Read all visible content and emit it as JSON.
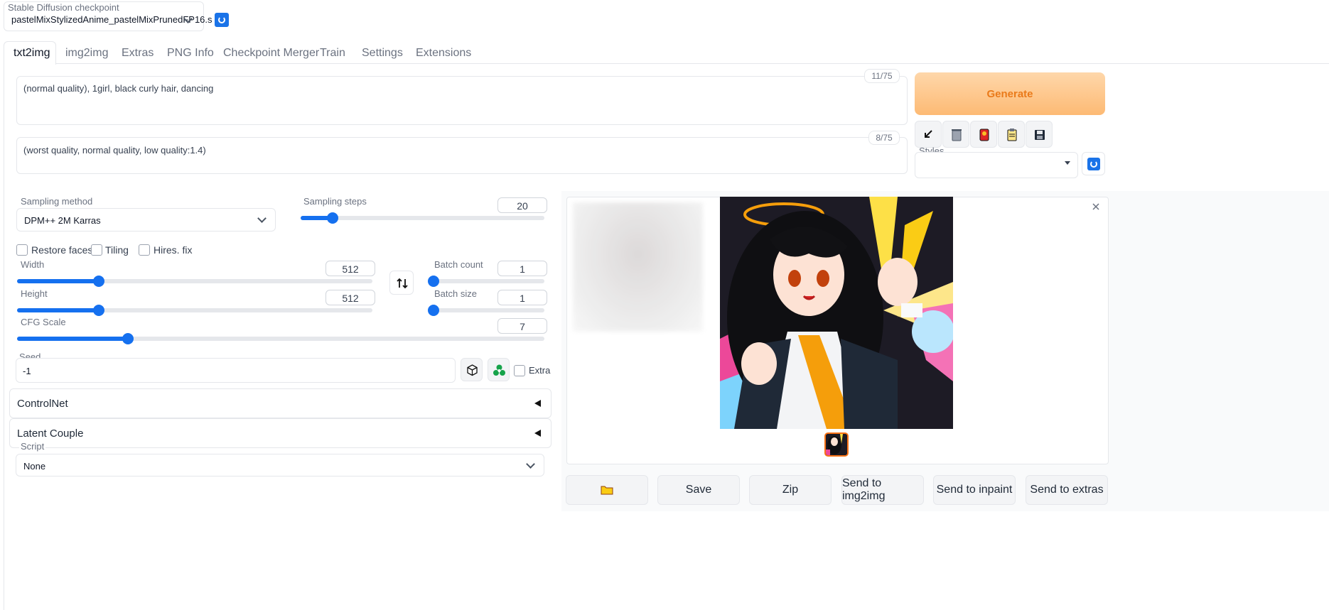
{
  "checkpoint": {
    "label": "Stable Diffusion checkpoint",
    "value": "pastelMixStylizedAnime_pastelMixPrunedFP16.s"
  },
  "tabs": [
    "txt2img",
    "img2img",
    "Extras",
    "PNG Info",
    "Checkpoint Merger",
    "Train",
    "Settings",
    "Extensions"
  ],
  "prompt": {
    "text": "(normal quality), 1girl, black curly hair, dancing",
    "token_count": "11/75"
  },
  "negative_prompt": {
    "text": "(worst quality, normal quality, low quality:1.4)",
    "token_count": "8/75"
  },
  "generate_label": "Generate",
  "styles_label": "Styles",
  "sampling": {
    "method_label": "Sampling method",
    "method_value": "DPM++ 2M Karras",
    "steps_label": "Sampling steps",
    "steps_value": "20",
    "steps_fraction": 0.13
  },
  "options": {
    "restore_faces": "Restore faces",
    "tiling": "Tiling",
    "hires_fix": "Hires. fix"
  },
  "width": {
    "label": "Width",
    "value": "512",
    "fraction": 0.23
  },
  "height": {
    "label": "Height",
    "value": "512",
    "fraction": 0.23
  },
  "batch_count": {
    "label": "Batch count",
    "value": "1",
    "fraction": 0.0
  },
  "batch_size": {
    "label": "Batch size",
    "value": "1",
    "fraction": 0.0
  },
  "cfg": {
    "label": "CFG Scale",
    "value": "7",
    "fraction": 0.21
  },
  "seed": {
    "label": "Seed",
    "value": "-1",
    "extra_label": "Extra"
  },
  "accordions": {
    "controlnet": "ControlNet",
    "latent_couple": "Latent Couple"
  },
  "script": {
    "label": "Script",
    "value": "None"
  },
  "output_buttons": {
    "save": "Save",
    "zip": "Zip",
    "send_img2img": "Send to img2img",
    "send_inpaint": "Send to inpaint",
    "send_extras": "Send to extras"
  },
  "colors": {
    "accent": "#1570ef",
    "generate_bg": "#fdc99c",
    "generate_text": "#ea7a1a"
  }
}
